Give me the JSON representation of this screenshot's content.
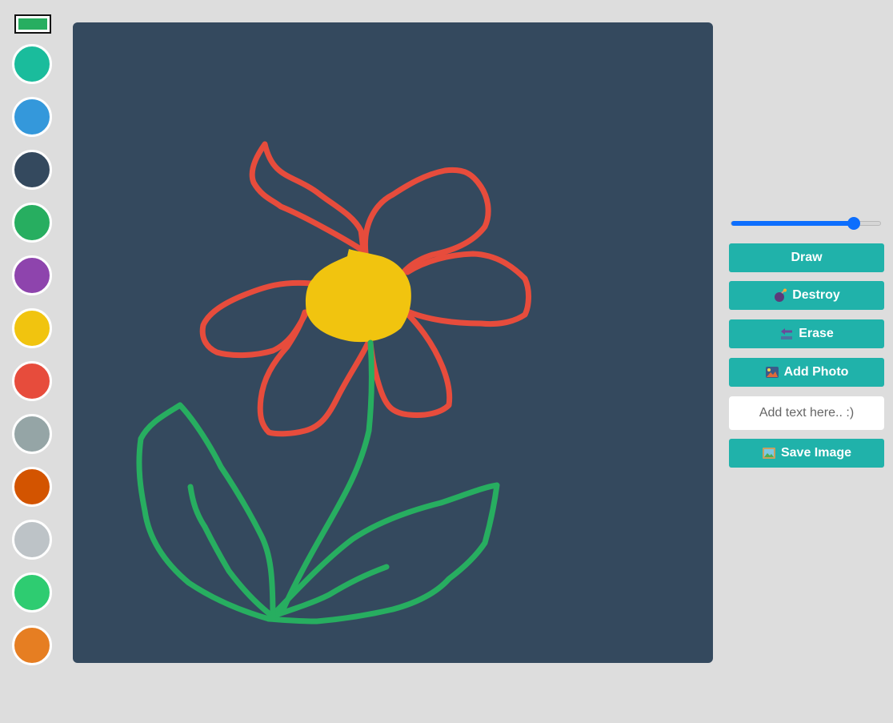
{
  "palette": {
    "current_color": "#27ae60",
    "colors": [
      "#1abc9c",
      "#3498db",
      "#34495e",
      "#27ae60",
      "#8e44ad",
      "#f1c40f",
      "#e74c3c",
      "#95a5a6",
      "#d35400",
      "#bdc3c7",
      "#2ecc71",
      "#e67e22"
    ]
  },
  "canvas": {
    "background": "#34495e",
    "drawing": "flower",
    "stroke_colors": {
      "petals": "#e74c3c",
      "center": "#f1c40f",
      "stem": "#27ae60"
    }
  },
  "controls": {
    "brush_size_level": 0.82,
    "accent": "#20b2aa",
    "draw_label": "Draw",
    "destroy_label": "Destroy",
    "destroy_icon": "bomb-icon",
    "erase_label": "Erase",
    "erase_icon": "back-arrow-icon",
    "add_photo_label": "Add Photo",
    "add_photo_icon": "photo-icon",
    "text_placeholder": "Add text here.. :)",
    "save_label": "Save Image",
    "save_icon": "framed-picture-icon"
  }
}
